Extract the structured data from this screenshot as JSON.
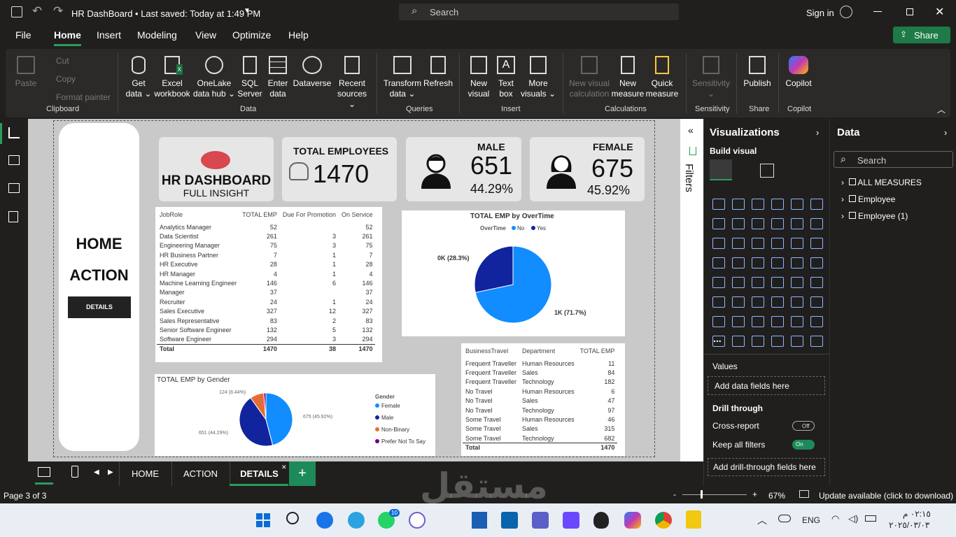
{
  "window": {
    "title": "HR DashBoard • Last saved: Today at 1:49 PM",
    "search_placeholder": "Search",
    "signin": "Sign in"
  },
  "menu": [
    "File",
    "Home",
    "Insert",
    "Modeling",
    "View",
    "Optimize",
    "Help"
  ],
  "share": "Share",
  "ribbon": {
    "clipboard": {
      "paste": "Paste",
      "cut": "Cut",
      "copy": "Copy",
      "format_painter": "Format painter",
      "group": "Clipboard"
    },
    "data": {
      "get_data": "Get data ⌄",
      "excel": "Excel workbook",
      "onelake": "OneLake data hub ⌄",
      "sql": "SQL Server",
      "enter": "Enter data",
      "dataverse": "Dataverse",
      "recent": "Recent sources ⌄",
      "group": "Data"
    },
    "queries": {
      "transform": "Transform data ⌄",
      "refresh": "Refresh",
      "group": "Queries"
    },
    "insert": {
      "new_visual": "New visual",
      "text_box": "Text box",
      "more_visuals": "More visuals ⌄",
      "group": "Insert"
    },
    "calculations": {
      "new_visual_calc": "New visual calculation",
      "new_measure": "New measure",
      "quick_measure": "Quick measure",
      "group": "Calculations"
    },
    "sensitivity": {
      "label": "Sensitivity ⌄",
      "group": "Sensitivity"
    },
    "share": {
      "publish": "Publish",
      "group": "Share"
    },
    "copilot": {
      "label": "Copilot",
      "group": "Copilot"
    }
  },
  "report": {
    "nav": {
      "home": "HOME",
      "action": "ACTION",
      "details": "DETAILS"
    },
    "title_card": {
      "title": "HR DASHBOARD",
      "subtitle": "FULL INSIGHT"
    },
    "total_card": {
      "label": "TOTAL EMPLOYEES",
      "value": "1470"
    },
    "male_card": {
      "label": "MALE",
      "value": "651",
      "pct": "44.29%"
    },
    "female_card": {
      "label": "FEMALE",
      "value": "675",
      "pct": "45.92%"
    },
    "role_table": {
      "headers": [
        "JobRole",
        "TOTAL EMP",
        "Due For Promotion",
        "On Service"
      ],
      "rows": [
        [
          "Analytics Manager",
          "52",
          "",
          "52"
        ],
        [
          "Data Scientist",
          "261",
          "3",
          "261"
        ],
        [
          "Engineering Manager",
          "75",
          "3",
          "75"
        ],
        [
          "HR Business Partner",
          "7",
          "1",
          "7"
        ],
        [
          "HR Executive",
          "28",
          "1",
          "28"
        ],
        [
          "HR Manager",
          "4",
          "1",
          "4"
        ],
        [
          "Machine Learning Engineer",
          "146",
          "6",
          "146"
        ],
        [
          "Manager",
          "37",
          "",
          "37"
        ],
        [
          "Recruiter",
          "24",
          "1",
          "24"
        ],
        [
          "Sales Executive",
          "327",
          "12",
          "327"
        ],
        [
          "Sales Representative",
          "83",
          "2",
          "83"
        ],
        [
          "Senior Software Engineer",
          "132",
          "5",
          "132"
        ],
        [
          "Software Engineer",
          "294",
          "3",
          "294"
        ]
      ],
      "total": [
        "Total",
        "1470",
        "38",
        "1470"
      ]
    },
    "travel_table": {
      "headers": [
        "BusinessTravel",
        "Department",
        "TOTAL EMP"
      ],
      "rows": [
        [
          "Frequent Traveller",
          "Human Resources",
          "11"
        ],
        [
          "Frequent Traveller",
          "Sales",
          "84"
        ],
        [
          "Frequent Traveller",
          "Technology",
          "182"
        ],
        [
          "No Travel",
          "Human Resources",
          "6"
        ],
        [
          "No Travel",
          "Sales",
          "47"
        ],
        [
          "No Travel",
          "Technology",
          "97"
        ],
        [
          "Some Travel",
          "Human Resources",
          "46"
        ],
        [
          "Some Travel",
          "Sales",
          "315"
        ],
        [
          "Some Travel",
          "Technology",
          "682"
        ]
      ],
      "total": [
        "Total",
        "",
        "1470"
      ]
    }
  },
  "chart_data": [
    {
      "type": "pie",
      "title": "TOTAL EMP by OverTime",
      "legend_title": "OverTime",
      "legend_position": "top-left",
      "categories": [
        "No",
        "Yes"
      ],
      "values": [
        1054,
        416
      ],
      "labels": [
        "1K (71.7%)",
        "0K (28.3%)"
      ],
      "colors": [
        "#118dff",
        "#12239e"
      ]
    },
    {
      "type": "pie",
      "title": "TOTAL EMP by Gender",
      "legend_title": "Gender",
      "legend_position": "right",
      "categories": [
        "Female",
        "Male",
        "Non-Binary",
        "Prefer Not To Say"
      ],
      "values": [
        675,
        651,
        124,
        20
      ],
      "labels": [
        "675 (45.92%)",
        "651 (44.29%)",
        "124 (8.44%)",
        ""
      ],
      "colors": [
        "#118dff",
        "#12239e",
        "#e66c37",
        "#6b007b"
      ]
    }
  ],
  "tabs": {
    "home": "HOME",
    "action": "ACTION",
    "details": "DETAILS",
    "add": "+",
    "filters": "Filters"
  },
  "viz_pane": {
    "title": "Visualizations",
    "build": "Build visual",
    "values": "Values",
    "add_fields": "Add data fields here",
    "drill": "Drill through",
    "cross": "Cross-report",
    "cross_state": "Off",
    "keep": "Keep all filters",
    "keep_state": "On",
    "add_drill": "Add drill-through fields here",
    "more": "..."
  },
  "data_pane": {
    "title": "Data",
    "search_placeholder": "Search",
    "items": [
      "ALL MEASURES",
      "Employee",
      "Employee (1)"
    ]
  },
  "status": {
    "page": "Page 3 of 3",
    "zoom": "67%",
    "update": "Update available (click to download)",
    "zoom_minus": "-",
    "zoom_plus": "+"
  },
  "taskbar": {
    "lang": "ENG",
    "time": "٠٢:١٥ م",
    "date": "٢٠٢٥/٠٣/٠٣",
    "badge": "10"
  },
  "watermark": "مستقل",
  "colors": {
    "accent": "#2a9d5c",
    "blue": "#118dff",
    "navy": "#12239e",
    "orange": "#e66c37",
    "purple": "#6b007b"
  }
}
